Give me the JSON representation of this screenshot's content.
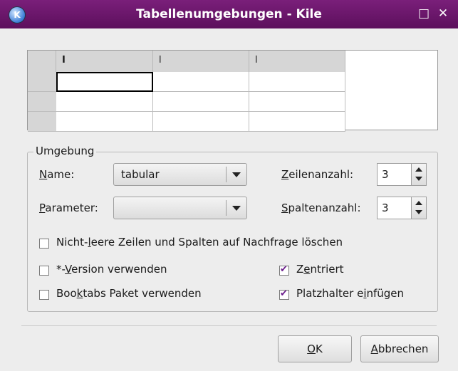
{
  "window": {
    "title": "Tabellenumgebungen - Kile",
    "app_icon": "kile-app-icon",
    "maximize_glyph": "□",
    "close_glyph": "✕"
  },
  "table": {
    "column_headers": [
      "I",
      "l",
      "l"
    ],
    "rows": [
      [
        "",
        "",
        ""
      ],
      [
        "",
        "",
        ""
      ],
      [
        "",
        "",
        ""
      ]
    ]
  },
  "environment": {
    "group_label": "Umgebung",
    "name_label": {
      "mnemonic": "N",
      "rest": "ame:"
    },
    "name_value": "tabular",
    "parameter_label": {
      "mnemonic": "P",
      "rest": "arameter:"
    },
    "parameter_value": "",
    "rows_label": {
      "mnemonic": "Z",
      "rest": "eilenanzahl:"
    },
    "rows_value": "3",
    "cols_label": {
      "mnemonic": "S",
      "rest": "paltenanzahl:"
    },
    "cols_value": "3"
  },
  "options": {
    "delete_empty": {
      "pre": "Nicht-",
      "mnemonic": "l",
      "post": "eere Zeilen und Spalten auf Nachfrage löschen",
      "checked": false
    },
    "star_version": {
      "pre": "*-",
      "mnemonic": "V",
      "post": "ersion verwenden",
      "checked": false
    },
    "booktabs": {
      "pre": "Boo",
      "mnemonic": "k",
      "post": "tabs Paket verwenden",
      "checked": false
    },
    "centered": {
      "pre": "Z",
      "mnemonic": "e",
      "post": "ntriert",
      "checked": true
    },
    "placeholder": {
      "pre": "Platzhalter e",
      "mnemonic": "i",
      "post": "nfügen",
      "checked": true
    }
  },
  "buttons": {
    "ok": {
      "mnemonic": "O",
      "rest": "K"
    },
    "cancel": {
      "mnemonic": "A",
      "rest": "bbrechen"
    }
  },
  "colors": {
    "titlebar": "#6b166b",
    "check": "#6b1c8c"
  }
}
